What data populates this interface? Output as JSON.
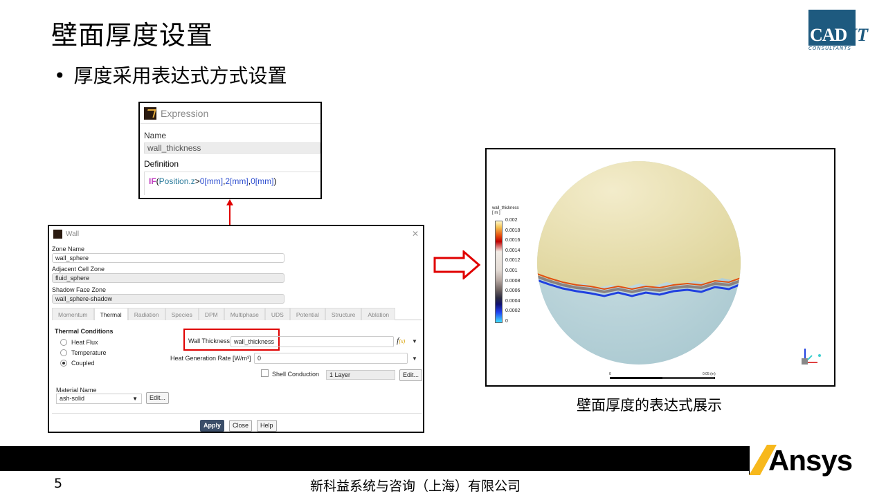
{
  "slide": {
    "title": "壁面厚度设置",
    "bullet": "厚度采用表达式方式设置",
    "caption": "壁面厚度的表达式展示",
    "page_number": "5",
    "company": "新科益系统与咨询（上海）有限公司",
    "brand": "Ansys"
  },
  "logo": {
    "main": "CAD",
    "suffix": "IT",
    "sub": "CONSULTANTS"
  },
  "expression": {
    "title": "Expression",
    "name_label": "Name",
    "name_value": "wall_thickness",
    "definition_label": "Definition",
    "def_fn": "IF",
    "def_open": "(",
    "def_var": "Position.z",
    "def_gt": ">",
    "def_unit1": "0[mm]",
    "def_comma1": ",",
    "def_unit2": "2[mm]",
    "def_comma2": ",",
    "def_unit3": "0[mm]",
    "def_close": ")"
  },
  "wall": {
    "title": "Wall",
    "zone_name_label": "Zone Name",
    "zone_name": "wall_sphere",
    "adjacent_label": "Adjacent Cell Zone",
    "adjacent": "fluid_sphere",
    "shadow_label": "Shadow Face Zone",
    "shadow": "wall_sphere-shadow",
    "tabs": [
      "Momentum",
      "Thermal",
      "Radiation",
      "Species",
      "DPM",
      "Multiphase",
      "UDS",
      "Potential",
      "Structure",
      "Ablation"
    ],
    "active_tab": "Thermal",
    "thermal_conditions": "Thermal Conditions",
    "radio": [
      "Heat Flux",
      "Temperature",
      "Coupled"
    ],
    "selected_radio": "Coupled",
    "wall_thickness_label": "Wall Thickness",
    "wall_thickness_value": "wall_thickness",
    "heat_gen_label": "Heat Generation Rate [W/m³]",
    "heat_gen_value": "0",
    "shell_conduction": "Shell Conduction",
    "layer": "1 Layer",
    "edit": "Edit...",
    "material_label": "Material Name",
    "material_value": "ash-solid",
    "apply": "Apply",
    "close": "Close",
    "help": "Help",
    "fx_f": "f",
    "fx_x": "(x)"
  },
  "contour": {
    "variable": "wall_thickness",
    "unit": "[ m ]",
    "ticks": [
      "0.002",
      "0.0018",
      "0.0016",
      "0.0014",
      "0.0012",
      "0.001",
      "0.0008",
      "0.0006",
      "0.0004",
      "0.0002",
      "0"
    ],
    "scale_start": "0",
    "scale_end": "0.05 (m)"
  },
  "colors": {
    "logo_blue": "#1e5a7f",
    "highlight_red": "#e00000",
    "apply_button": "#3b4e69",
    "sphere_top": "#ece4b4",
    "sphere_bottom": "#bcd6dc"
  }
}
